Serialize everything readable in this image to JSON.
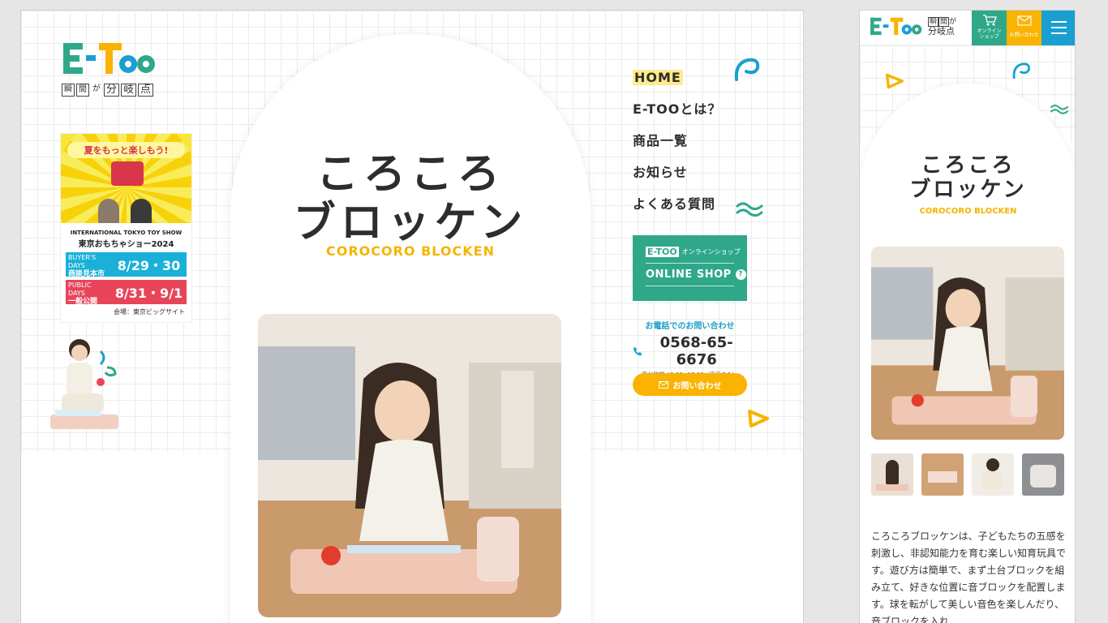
{
  "brand": {
    "logo_text": "E-TOO",
    "tagline": [
      "瞬",
      "間",
      "が",
      "分",
      "岐",
      "点"
    ],
    "colors": {
      "green": "#2fa88a",
      "yellow": "#f9b300",
      "blue": "#1a9fd0",
      "title": "#2d2d2d"
    }
  },
  "banner": {
    "headline": "夏をもっと楽しもう!",
    "show_en": "INTERNATIONAL TOKYO TOY SHOW",
    "show_jp": "東京おもちゃショー2024",
    "rows": [
      {
        "tag_en": "BUYER'S DAYS",
        "tag_jp": "商談見本市",
        "dates": "8/29・30",
        "color": "#1ab0d8"
      },
      {
        "tag_en": "PUBLIC DAYS",
        "tag_jp": "一般公開",
        "dates": "8/31・9/1",
        "color": "#e8455b"
      }
    ],
    "venue": "会場：東京ビッグサイト"
  },
  "product": {
    "title_line1": "ころころ",
    "title_line2": "ブロッケン",
    "subtitle": "COROCORO BLOCKEN"
  },
  "nav": {
    "items": [
      {
        "label": "HOME",
        "active": true
      },
      {
        "label": "E-TOOとは？",
        "active": false
      },
      {
        "label": "商品一覧",
        "active": false
      },
      {
        "label": "お知らせ",
        "active": false
      },
      {
        "label": "よくある質問",
        "active": false
      }
    ]
  },
  "shop": {
    "mini_label": "オンラインショップ",
    "big_label": "ONLINE SHOP"
  },
  "contact": {
    "phone_label": "お電話でのお問い合わせ",
    "phone": "0568-65-6676",
    "hours": "受付時間 / 9:00~17:00（平日のみ）",
    "button_label": "お問い合わせ"
  },
  "mobile": {
    "cart_label": "オンライン\nショップ",
    "mail_label": "お問い合わせ",
    "description": "ころころブロッケンは、子どもたちの五感を刺激し、非認知能力を育む楽しい知育玩具です。遊び方は簡単で、まず土台ブロックを組み立て、好きな位置に音ブロックを配置します。球を転がして美しい音色を楽しんだり、音ブロックを入れ"
  },
  "icons": [
    "cart-icon",
    "mail-icon",
    "menu-icon",
    "phone-icon",
    "question-icon"
  ]
}
